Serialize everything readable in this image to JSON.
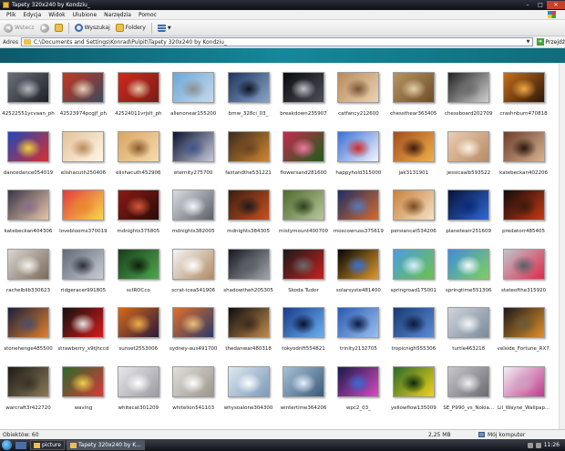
{
  "window": {
    "title": "Tapety 320x240 by Kondziu_"
  },
  "menu": [
    "Plik",
    "Edycja",
    "Widok",
    "Ulubione",
    "Narzędzia",
    "Pomoc"
  ],
  "toolbar": {
    "back_label": "Wstecz",
    "search_label": "Wyszukaj",
    "folders_label": "Foldery"
  },
  "address": {
    "label": "Adres",
    "path": "C:\\Documents and Settings\\Konrad\\Pulpit\\Tapety 320x240 by Kondziu_",
    "go_label": "Przejdź"
  },
  "files": [
    {
      "name": "42522551ycvaan_ph",
      "colors": [
        "#6b6f78",
        "#1e2126",
        "#b4b8c0"
      ]
    },
    {
      "name": "42523974pcgjf_ph",
      "colors": [
        "#c8351f",
        "#3c4a5e",
        "#e8d0b8"
      ]
    },
    {
      "name": "42524011vrjslt_ph",
      "colors": [
        "#cf2a1e",
        "#7b1c18",
        "#e7c9a7"
      ]
    },
    {
      "name": "alienonear155200",
      "colors": [
        "#6ba7d9",
        "#c7d9e9",
        "#8c8f92"
      ]
    },
    {
      "name": "bmw_328ci_03_",
      "colors": [
        "#1e3560",
        "#8aa3c5",
        "#0c1424"
      ]
    },
    {
      "name": "breakdown235907",
      "colors": [
        "#0a0a0c",
        "#4c4f58",
        "#c0c2c8"
      ]
    },
    {
      "name": "catfancy212600",
      "colors": [
        "#b98b5c",
        "#e9d3b4",
        "#7a5534"
      ]
    },
    {
      "name": "chessthear363405",
      "colors": [
        "#b79461",
        "#6d4d2b",
        "#e5cfa8"
      ]
    },
    {
      "name": "chessboard202709",
      "colors": [
        "#232323",
        "#cfcfcf",
        "#6b6b6b"
      ]
    },
    {
      "name": "crashnburn470818",
      "colors": [
        "#c76f1c",
        "#2b1608",
        "#f0a944"
      ]
    },
    {
      "name": "dancedance054019",
      "colors": [
        "#1f48b8",
        "#d82f2f",
        "#f2d23c"
      ]
    },
    {
      "name": "elishacuth250406",
      "colors": [
        "#e4c29a",
        "#fff6e6",
        "#b98a5c"
      ]
    },
    {
      "name": "elishacuth452906",
      "colors": [
        "#d9a462",
        "#f4dcae",
        "#8b5a2b"
      ]
    },
    {
      "name": "eternity275700",
      "colors": [
        "#0a1230",
        "#c5c9d8",
        "#40548f"
      ]
    },
    {
      "name": "fastandthe531221",
      "colors": [
        "#3b2b1e",
        "#d0862f",
        "#6b4423"
      ]
    },
    {
      "name": "flowersand281600",
      "colors": [
        "#c72a4f",
        "#1a5f1a",
        "#f07aa0"
      ]
    },
    {
      "name": "happyhold315000",
      "colors": [
        "#3b6fd4",
        "#f2f6ff",
        "#d02a2a"
      ]
    },
    {
      "name": "jak3131901",
      "colors": [
        "#a34d1c",
        "#f0b04a",
        "#3e1a0a"
      ]
    },
    {
      "name": "jessicaalb593522",
      "colors": [
        "#e9cdb2",
        "#b98a64",
        "#fff2e6"
      ]
    },
    {
      "name": "katebeckan402206",
      "colors": [
        "#6b3e2a",
        "#d8b392",
        "#2a160c"
      ]
    },
    {
      "name": "katebeckan404306",
      "colors": [
        "#3a3548",
        "#e5c5a8",
        "#8a6d8a"
      ]
    },
    {
      "name": "loveblooms370019",
      "colors": [
        "#e23a3a",
        "#f7d84a",
        "#e8872c"
      ]
    },
    {
      "name": "mdnights375805",
      "colors": [
        "#8b1a14",
        "#2a0c0a",
        "#d45a3a"
      ]
    },
    {
      "name": "mdnights382005",
      "colors": [
        "#d9dde2",
        "#5b6068",
        "#f4f6f8"
      ]
    },
    {
      "name": "mdnights384305",
      "colors": [
        "#3b1e10",
        "#c7501e",
        "#1b1b1f"
      ]
    },
    {
      "name": "mistymount400700",
      "colors": [
        "#4f6a2e",
        "#b7c89b",
        "#2c3f1a"
      ]
    },
    {
      "name": "moscowruss375619",
      "colors": [
        "#1d2f66",
        "#d86a2a",
        "#5a78b8"
      ]
    },
    {
      "name": "persiancat534206",
      "colors": [
        "#c9803c",
        "#f5e2c6",
        "#7a4b1f"
      ]
    },
    {
      "name": "planetearr251609",
      "colors": [
        "#061238",
        "#2f6ad6",
        "#0a2a7a"
      ]
    },
    {
      "name": "predatorr485405",
      "colors": [
        "#0e0b0a",
        "#c63a14",
        "#3b1a0c"
      ]
    },
    {
      "name": "rachelbilb330623",
      "colors": [
        "#d9d6d0",
        "#7a6a5a",
        "#f6f4f0"
      ]
    },
    {
      "name": "ridgeracer991805",
      "colors": [
        "#626a78",
        "#c8ccd4",
        "#2b2f38"
      ]
    },
    {
      "name": "scIROCco",
      "colors": [
        "#1a3d1a",
        "#4ea84e",
        "#0c1f0c"
      ]
    },
    {
      "name": "scrat-icea541906",
      "colors": [
        "#f4f4f4",
        "#b28b62",
        "#ffffff"
      ]
    },
    {
      "name": "shadowtheh205305",
      "colors": [
        "#17191f",
        "#a0a4ab",
        "#5a5e66"
      ]
    },
    {
      "name": "Skoda Tudor",
      "colors": [
        "#1a1a1a",
        "#c62020",
        "#6b6b6b"
      ]
    },
    {
      "name": "solarsyste481400",
      "colors": [
        "#050505",
        "#e09a2a",
        "#3b6fd4"
      ]
    },
    {
      "name": "springroad175001",
      "colors": [
        "#4a9de0",
        "#6cc24a",
        "#d9f0ff"
      ]
    },
    {
      "name": "springtime551306",
      "colors": [
        "#3d8be0",
        "#7ed15a",
        "#f4fbff"
      ]
    },
    {
      "name": "stateofthe315920",
      "colors": [
        "#c0c4cc",
        "#e02a4a",
        "#5a5e66"
      ]
    },
    {
      "name": "stonehenge485500",
      "colors": [
        "#1a1f3a",
        "#e0802a",
        "#4a4e6a"
      ]
    },
    {
      "name": "strawberry_x9tjhccd",
      "colors": [
        "#111111",
        "#d81a1a",
        "#e8e8e8"
      ]
    },
    {
      "name": "sunset2553006",
      "colors": [
        "#d86a1a",
        "#2a1a3a",
        "#f0b04a"
      ]
    },
    {
      "name": "sydney-aus491700",
      "colors": [
        "#e0702a",
        "#2a3a6a",
        "#f0c07a"
      ]
    },
    {
      "name": "thedanwar480318",
      "colors": [
        "#0c0c10",
        "#c08a4a",
        "#3a2a1a"
      ]
    },
    {
      "name": "tokyodrift554821",
      "colors": [
        "#1a3a8a",
        "#6ab0f0",
        "#0a1030"
      ]
    },
    {
      "name": "trinity2132705",
      "colors": [
        "#2a5ab0",
        "#9ac0f0",
        "#0c1a40"
      ]
    },
    {
      "name": "tropicnigh555306",
      "colors": [
        "#1a3a70",
        "#5a8ad8",
        "#0a1a3a"
      ]
    },
    {
      "name": "turtle463218",
      "colors": [
        "#d0d4dc",
        "#7a8a9a",
        "#f4f6f8"
      ]
    },
    {
      "name": "velside_Fortune_RX7...",
      "colors": [
        "#1a1a1a",
        "#e0902a",
        "#6a5a3a"
      ]
    },
    {
      "name": "warcraft3r422720",
      "colors": [
        "#1c1a14",
        "#8a7a5a",
        "#3a3226"
      ]
    },
    {
      "name": "waving",
      "colors": [
        "#2a6a2a",
        "#d83a3a",
        "#f0d04a"
      ]
    },
    {
      "name": "whitecat301209",
      "colors": [
        "#e8e8ea",
        "#9a9aa2",
        "#ffffff"
      ]
    },
    {
      "name": "whitelion541103",
      "colors": [
        "#e2e0dc",
        "#9a948a",
        "#ffffff"
      ]
    },
    {
      "name": "whysoalone304300",
      "colors": [
        "#dfe8f0",
        "#7a9ab8",
        "#ffffff"
      ]
    },
    {
      "name": "wintertime364206",
      "colors": [
        "#a8c0d8",
        "#3a5a7a",
        "#e8f0f8"
      ]
    },
    {
      "name": "wpc2_03_",
      "colors": [
        "#1a1a4a",
        "#d84ac0",
        "#3a6ad8"
      ]
    },
    {
      "name": "yellowflow135009",
      "colors": [
        "#2a6a2a",
        "#f0d41a",
        "#0c2a0c"
      ]
    },
    {
      "name": "SE_P990_vs_Nokia...",
      "colors": [
        "#c8c8cc",
        "#6a6a72",
        "#f0f0f2"
      ]
    },
    {
      "name": "Lil_Wayne_Wallpap...",
      "colors": [
        "#f0f0f6",
        "#c03a8a",
        "#d0a0c0"
      ]
    }
  ],
  "status": {
    "objects": "Obiektów: 60",
    "size": "2,25 MB",
    "location": "Mój komputer"
  },
  "taskbar": {
    "items": [
      "picture",
      "Tapety 320x240 by K..."
    ],
    "clock": "11:26"
  },
  "icons": {
    "back": "back-arrow-icon",
    "forward": "forward-arrow-icon",
    "up": "folder-up-icon",
    "search": "search-icon",
    "folders": "folders-icon",
    "views": "views-icon"
  }
}
